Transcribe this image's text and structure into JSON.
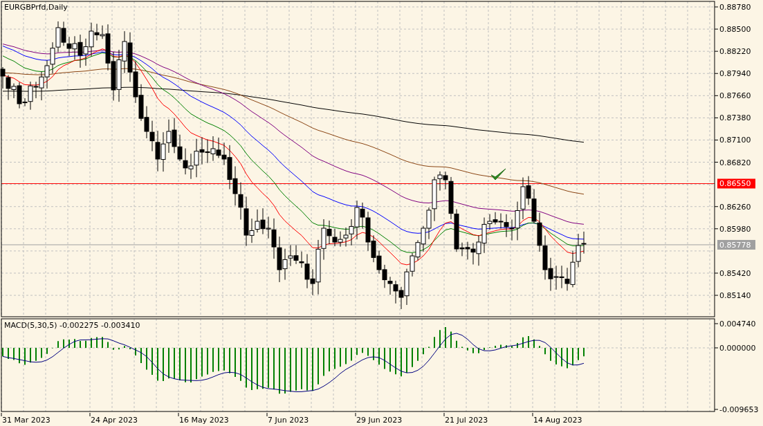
{
  "symbol_label": "EURGBPrfd,Daily",
  "price_axis": {
    "ticks": [
      "0.88780",
      "0.88500",
      "0.88220",
      "0.87940",
      "0.87660",
      "0.87380",
      "0.87100",
      "0.86820",
      "0.86260",
      "0.85980",
      "0.85420",
      "0.85140"
    ]
  },
  "level_tag": "0.86550",
  "bid_tag": "0.85778",
  "macd": {
    "label": "MACD(5,30,5) -0.002275 -0.003410",
    "ticks": [
      "0.004740",
      "0.000000",
      "-0.009653"
    ]
  },
  "time_axis": [
    "31 Mar 2023",
    "24 Apr 2023",
    "16 May 2023",
    "7 Jun 2023",
    "29 Jun 2023",
    "21 Jul 2023",
    "14 Aug 2023"
  ]
}
